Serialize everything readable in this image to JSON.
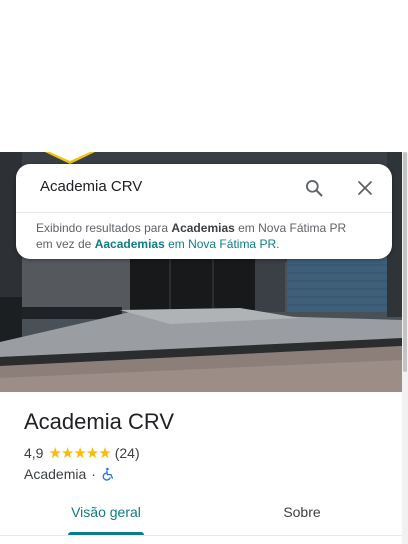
{
  "search": {
    "query": "Academia CRV",
    "notice_prefix": "Exibindo resultados para ",
    "notice_term": "Academias",
    "notice_middle": " em Nova Fátima PR",
    "notice_prefix2": "em vez de ",
    "notice_original_term": "Aacademias",
    "notice_original_location": " em Nova Fátima PR",
    "notice_end": "."
  },
  "place": {
    "title": "Academia CRV",
    "rating": "4,9",
    "stars": "★★★★★",
    "review_count": "(24)",
    "category": "Academia",
    "separator": "·",
    "accessibility_icon": "wheelchair-icon"
  },
  "tabs": [
    {
      "label": "Visão geral",
      "active": true
    },
    {
      "label": "Sobre",
      "active": false
    }
  ],
  "colors": {
    "accent": "#0e7c86",
    "star": "#fbbc04",
    "link": "#1a73e8",
    "accessibility": "#1a73e8"
  }
}
